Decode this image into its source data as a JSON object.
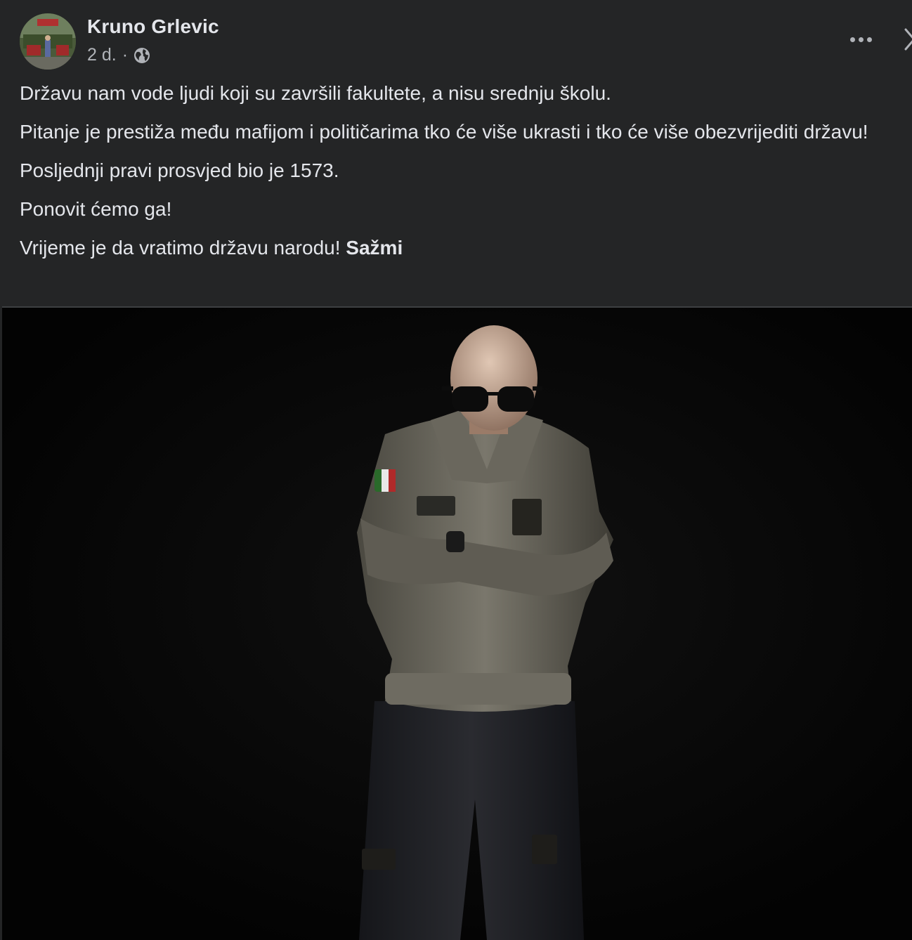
{
  "post": {
    "author": "Kruno Grlevic",
    "time": "2 d.",
    "separator": "·",
    "privacy_icon": "globe-icon",
    "more_icon": "more-horizontal-icon",
    "close_icon": "close-icon",
    "paragraphs": [
      "Državu nam vode ljudi koji su završili fakultete, a nisu srednju školu.",
      "Pitanje je prestiža među mafijom i političarima tko će više ukrasti i tko će više obezvrijediti državu!",
      "Posljednji pravi prosvjed bio je 1573.",
      "Ponovit ćemo ga!"
    ],
    "last_paragraph": "Vrijeme je da vratimo državu narodu!",
    "see_less_label": "Sažmi"
  },
  "colors": {
    "background": "#242526",
    "text_primary": "#e4e6eb",
    "text_secondary": "#b0b3b8",
    "photo_background": "#050505"
  }
}
